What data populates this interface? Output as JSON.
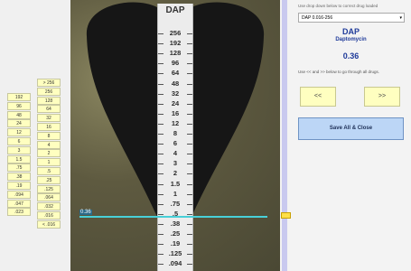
{
  "left_ladder": {
    "col_a": [
      "192",
      "96",
      "48",
      "24",
      "12",
      "6",
      "3",
      "1.5",
      ".75",
      ".38",
      ".19",
      ".094",
      ".047",
      ".023"
    ],
    "col_b": [
      "> 256",
      "256",
      "128",
      "64",
      "32",
      "16",
      "8",
      "4",
      "2",
      "1",
      ".5",
      ".25",
      ".125",
      ".064",
      ".032",
      ".016",
      "< .016"
    ]
  },
  "strip": {
    "title": "DAP",
    "ticks": [
      "256",
      "192",
      "128",
      "96",
      "64",
      "48",
      "32",
      "24",
      "16",
      "12",
      "8",
      "6",
      "4",
      "3",
      "2",
      "1.5",
      "1",
      ".75",
      ".5",
      ".38",
      ".25",
      ".19",
      ".125",
      ".094",
      ".064"
    ],
    "reading_label": "0.36"
  },
  "right": {
    "hint_top": "Use drop down below to correct drug loaded",
    "selected_drug": "DAP  0.016-256",
    "drug_code": "DAP",
    "drug_name": "Daptomycin",
    "mic_value": "0.36",
    "nav_hint": "Use << and >> below to go through all drugs.",
    "prev_label": "<<",
    "next_label": ">>",
    "save_label": "Save All & Close"
  },
  "colors": {
    "reading_line": "#48d0d8",
    "cell_bg": "#ffffc0",
    "save_bg": "#bcd6f6",
    "title_blue": "#1f3b9a"
  }
}
